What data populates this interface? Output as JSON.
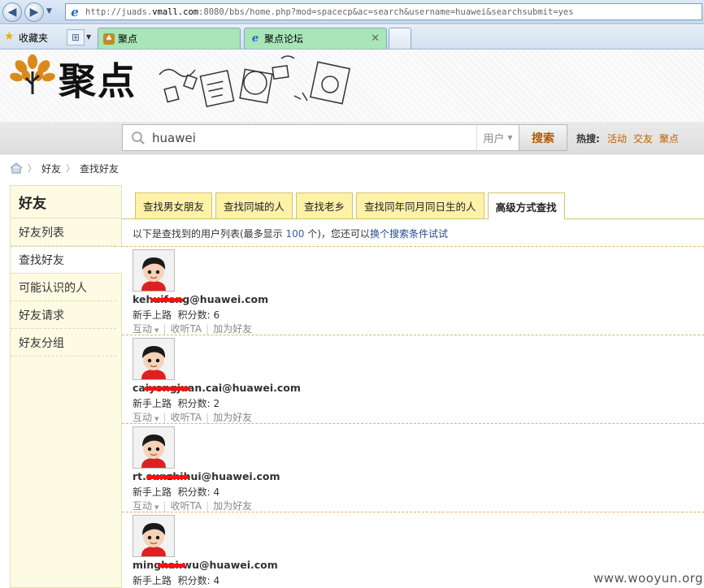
{
  "browser": {
    "url_prefix": "http://juads.",
    "url_domain": "vmall.com",
    "url_suffix": ":8080/bbs/home.php?mod=spacecp&ac=search&username=huawei&searchsubmit=yes",
    "favorites_label": "收藏夹",
    "tabs": [
      {
        "label": "聚点"
      },
      {
        "label": "聚点论坛"
      }
    ]
  },
  "site": {
    "logo_text": "聚点",
    "search": {
      "value": "huawei",
      "scope": "用户",
      "button": "搜索"
    },
    "hot": {
      "label": "热搜:",
      "links": [
        "活动",
        "交友",
        "聚点"
      ]
    }
  },
  "breadcrumb": [
    "好友",
    "查找好友"
  ],
  "sidebar": {
    "title": "好友",
    "items": [
      {
        "label": "好友列表",
        "active": false
      },
      {
        "label": "查找好友",
        "active": true
      },
      {
        "label": "可能认识的人",
        "active": false
      },
      {
        "label": "好友请求",
        "active": false
      },
      {
        "label": "好友分组",
        "active": false
      }
    ]
  },
  "main": {
    "tabs": [
      "查找男女朋友",
      "查找同城的人",
      "查找老乡",
      "查找同年同月同日生的人",
      "高级方式查找"
    ],
    "active_tab": 4,
    "notice_before": "以下是查找到的用户列表(最多显示",
    "notice_count": "100",
    "notice_unit": "个)，您还可以",
    "notice_link": "换个搜索条件试试",
    "users": [
      {
        "email": "kehuifeng@huawei.com",
        "level": "新手上路",
        "points_label": "积分数:",
        "points": "6"
      },
      {
        "email": "caiyongjuan.cai@huawei.com",
        "level": "新手上路",
        "points_label": "积分数:",
        "points": "2"
      },
      {
        "email": "rt.sunzhihui@huawei.com",
        "level": "新手上路",
        "points_label": "积分数:",
        "points": "4"
      },
      {
        "email": "minghai.wu@huawei.com",
        "level": "新手上路",
        "points_label": "积分数:",
        "points": "4"
      }
    ],
    "actions": {
      "interact": "互动",
      "follow": "收听TA",
      "add_friend": "加为好友"
    }
  },
  "watermark": "www.wooyun.org"
}
